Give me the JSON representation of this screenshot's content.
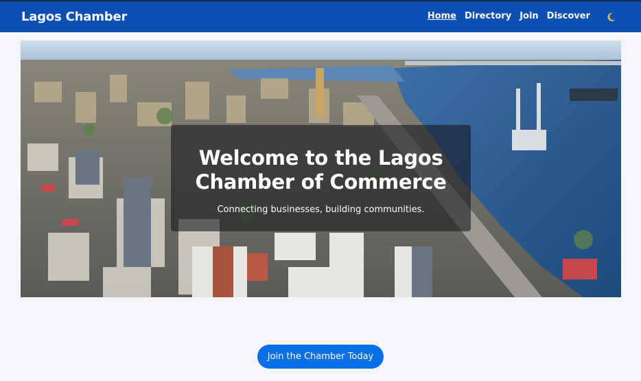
{
  "header": {
    "brand": "Lagos Chamber",
    "nav": [
      {
        "label": "Home",
        "active": true
      },
      {
        "label": "Directory",
        "active": false
      },
      {
        "label": "Join",
        "active": false
      },
      {
        "label": "Discover",
        "active": false
      }
    ],
    "theme_toggle_icon": "moon-icon"
  },
  "hero": {
    "image": "lagos-city-aerial-photo",
    "title_line1": "Welcome to the Lagos",
    "title_line2": "Chamber of Commerce",
    "subtitle": "Connecting businesses, building communities."
  },
  "cta": {
    "label": "Join the Chamber Today"
  },
  "colors": {
    "header_bg": "#0b4fb1",
    "page_bg": "#f5f6f9",
    "cta_bg": "#0a6fe6",
    "moon": "#f4b942"
  }
}
